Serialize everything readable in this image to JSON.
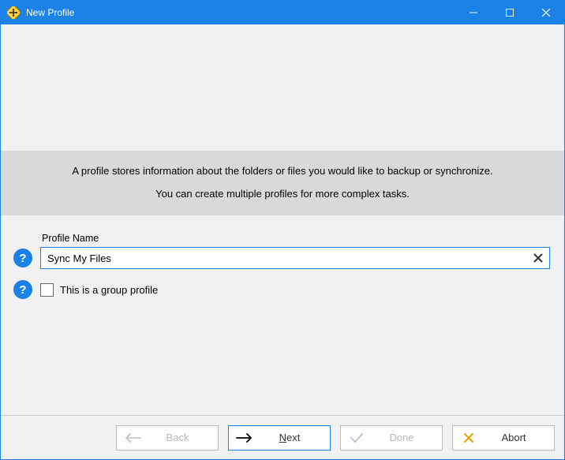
{
  "window": {
    "title": "New Profile"
  },
  "info": {
    "line1": "A profile stores information about the folders or files you would like to backup or synchronize.",
    "line2": "You can create multiple profiles for more complex tasks."
  },
  "form": {
    "profile_name_label": "Profile Name",
    "profile_name_value": "Sync My Files",
    "group_profile_label": "This is a group profile",
    "group_profile_checked": false
  },
  "buttons": {
    "back": "Back",
    "next": "Next",
    "done": "Done",
    "abort": "Abort"
  },
  "help_glyph": "?"
}
